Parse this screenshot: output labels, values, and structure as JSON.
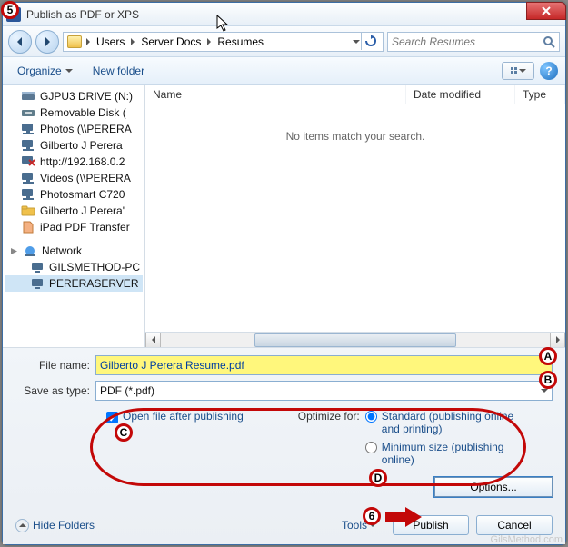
{
  "window": {
    "title": "Publish as PDF or XPS"
  },
  "breadcrumb": {
    "items": [
      "Users",
      "Server Docs",
      "Resumes"
    ]
  },
  "search": {
    "placeholder": "Search Resumes"
  },
  "toolbar": {
    "organize": "Organize",
    "new_folder": "New folder"
  },
  "tree": {
    "drives": [
      {
        "label": "GJPU3 DRIVE (N:)",
        "icon": "drive"
      },
      {
        "label": "Removable Disk (",
        "icon": "removable"
      },
      {
        "label": "Photos (\\\\PERERA",
        "icon": "netshare"
      },
      {
        "label": "Gilberto J Perera",
        "icon": "netshare"
      },
      {
        "label": "http://192.168.0.2",
        "icon": "netshare-x"
      },
      {
        "label": "Videos (\\\\PERERA",
        "icon": "netshare"
      },
      {
        "label": "Photosmart C720",
        "icon": "netshare"
      },
      {
        "label": "Gilberto J Perera'",
        "icon": "folder"
      },
      {
        "label": "iPad PDF Transfer",
        "icon": "file"
      }
    ],
    "network_header": "Network",
    "network_items": [
      {
        "label": "GILSMETHOD-PC"
      },
      {
        "label": "PERERASERVER"
      }
    ]
  },
  "list": {
    "columns": {
      "name": "Name",
      "date": "Date modified",
      "type": "Type"
    },
    "empty": "No items match your search."
  },
  "fields": {
    "filename_label": "File name:",
    "filename_value": "Gilberto J Perera Resume.pdf",
    "savetype_label": "Save as type:",
    "savetype_value": "PDF (*.pdf)"
  },
  "options": {
    "open_after": "Open file after publishing",
    "optimize_label": "Optimize for:",
    "standard": "Standard (publishing online and printing)",
    "minimum": "Minimum size (publishing online)",
    "options_button": "Options..."
  },
  "footer": {
    "hide_folders": "Hide Folders",
    "tools": "Tools",
    "publish": "Publish",
    "cancel": "Cancel"
  },
  "annotations": {
    "step5": "5",
    "step6": "6",
    "markerA": "A",
    "markerB": "B",
    "markerC": "C",
    "markerD": "D"
  },
  "watermark": "GilsMethod.com"
}
